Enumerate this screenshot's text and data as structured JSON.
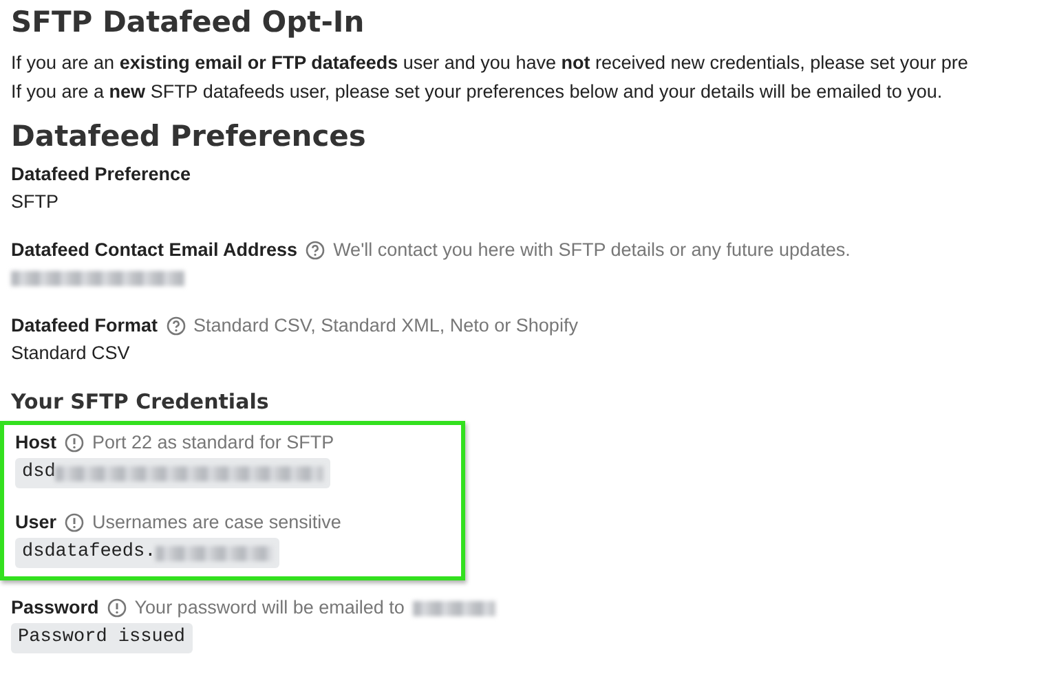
{
  "title": "SFTP Datafeed Opt-In",
  "intro": [
    "If you are an **existing email or FTP datafeeds** user and you have **not** received new credentials, please set your pre",
    "If you are a **new** SFTP datafeeds user, please set your preferences below and your details will be emailed to you."
  ],
  "preferences": {
    "heading": "Datafeed Preferences",
    "fields": [
      {
        "label": "Datafeed Preference",
        "value": "SFTP"
      },
      {
        "label": "Datafeed Contact Email Address",
        "kind": "question",
        "hint": "We'll contact you here with SFTP details or any future updates.",
        "redacted": true
      },
      {
        "label": "Datafeed Format",
        "kind": "question",
        "hint": "Standard CSV, Standard XML, Neto or Shopify",
        "value": "Standard CSV"
      }
    ]
  },
  "credentials": {
    "heading": "Your SFTP Credentials",
    "highlight_box": {
      "fields": [
        {
          "label": "Host",
          "kind": "info",
          "hint": "Port 22 as standard for SFTP",
          "code": "dsd",
          "redacted": true
        },
        {
          "label": "User",
          "kind": "info",
          "hint": "Usernames are case sensitive",
          "code": "dsdatafeeds.",
          "redacted": true
        }
      ]
    },
    "fields": [
      {
        "label": "Password",
        "kind": "info",
        "hint": "Your password will be emailed to",
        "hint_redacted": true,
        "code": "Password issued"
      }
    ]
  }
}
